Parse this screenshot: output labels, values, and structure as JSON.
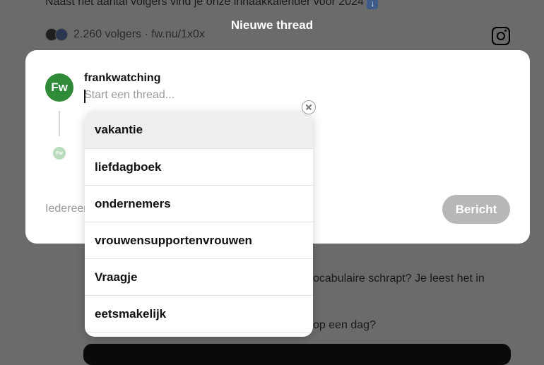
{
  "background": {
    "line1": "Naast het aantal volgers vind je onze inhaakkalender voor 2024",
    "line1_icon": "down-arrow-emoji-icon",
    "followers": "2.260 volgers · fw.nu/1x0x",
    "line2": "ocabulaire schrapt? Je leest het in",
    "line3": "op een dag?",
    "instagram_icon": "instagram-icon"
  },
  "modal": {
    "title": "Nieuwe thread",
    "avatar_initials": "Fw",
    "username": "frankwatching",
    "composer_placeholder": "Start een thread...",
    "reply_label": "Iedereen",
    "post_button": "Bericht"
  },
  "suggestions": {
    "items": [
      "vakantie",
      "liefdagboek",
      "ondernemers",
      "vrouwensupportenvrouwen",
      "Vraagje",
      "eetsmakelijk"
    ],
    "active_index": 0
  },
  "colors": {
    "avatar": "#2f8a3a",
    "post_button_disabled": "#b7b7b7",
    "overlay": "#6b6b6b"
  }
}
